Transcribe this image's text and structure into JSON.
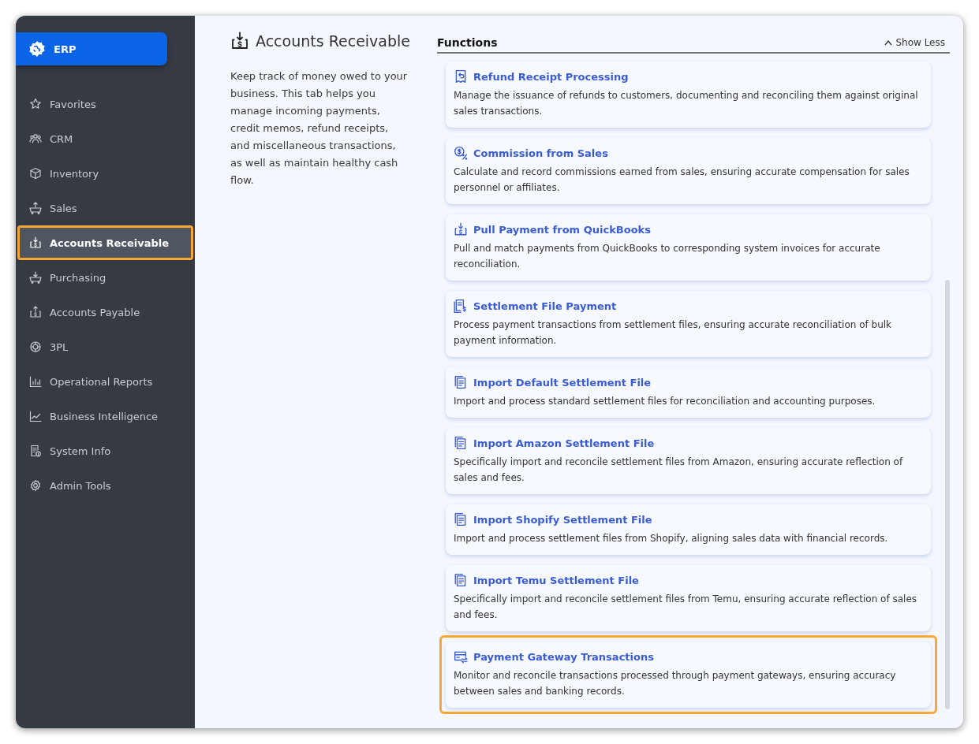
{
  "app": {
    "title": "ERP"
  },
  "sidebar": {
    "items": [
      {
        "label": "Favorites",
        "selected": false,
        "highlighted": false
      },
      {
        "label": "CRM",
        "selected": false,
        "highlighted": false
      },
      {
        "label": "Inventory",
        "selected": false,
        "highlighted": false
      },
      {
        "label": "Sales",
        "selected": false,
        "highlighted": false
      },
      {
        "label": "Accounts Receivable",
        "selected": true,
        "highlighted": true
      },
      {
        "label": "Purchasing",
        "selected": false,
        "highlighted": false
      },
      {
        "label": "Accounts Payable",
        "selected": false,
        "highlighted": false
      },
      {
        "label": "3PL",
        "selected": false,
        "highlighted": false
      },
      {
        "label": "Operational Reports",
        "selected": false,
        "highlighted": false
      },
      {
        "label": "Business Intelligence",
        "selected": false,
        "highlighted": false
      },
      {
        "label": "System Info",
        "selected": false,
        "highlighted": false
      },
      {
        "label": "Admin Tools",
        "selected": false,
        "highlighted": false
      }
    ]
  },
  "section": {
    "title": "Accounts Receivable",
    "description": "Keep track of money owed to your business. This tab helps you manage incoming payments, credit memos, refund receipts, and miscellaneous transactions, as well as maintain healthy cash flow."
  },
  "functions": {
    "heading": "Functions",
    "toggle": "Show Less",
    "cards": [
      {
        "title": "Refund Receipt Processing",
        "description": "Manage the issuance of refunds to customers, documenting and reconciling them against original sales transactions.",
        "highlighted": false
      },
      {
        "title": "Commission from Sales",
        "description": "Calculate and record commissions earned from sales, ensuring accurate compensation for sales personnel or affiliates.",
        "highlighted": false
      },
      {
        "title": "Pull Payment from QuickBooks",
        "description": "Pull and match payments from QuickBooks to corresponding system invoices for accurate reconciliation.",
        "highlighted": false
      },
      {
        "title": "Settlement File Payment",
        "description": "Process payment transactions from settlement files, ensuring accurate reconciliation of bulk payment information.",
        "highlighted": false
      },
      {
        "title": "Import Default Settlement File",
        "description": "Import and process standard settlement files for reconciliation and accounting purposes.",
        "highlighted": false
      },
      {
        "title": "Import Amazon Settlement File",
        "description": "Specifically import and reconcile settlement files from Amazon, ensuring accurate reflection of sales and fees.",
        "highlighted": false
      },
      {
        "title": "Import Shopify Settlement File",
        "description": "Import and process settlement files from Shopify, aligning sales data with financial records.",
        "highlighted": false
      },
      {
        "title": "Import Temu Settlement File",
        "description": "Specifically import and reconcile settlement files from Temu, ensuring accurate reflection of sales and fees.",
        "highlighted": false
      },
      {
        "title": "Payment Gateway Transactions",
        "description": "Monitor and reconcile transactions processed through payment gateways, ensuring accuracy between sales and banking records.",
        "highlighted": true
      }
    ]
  }
}
